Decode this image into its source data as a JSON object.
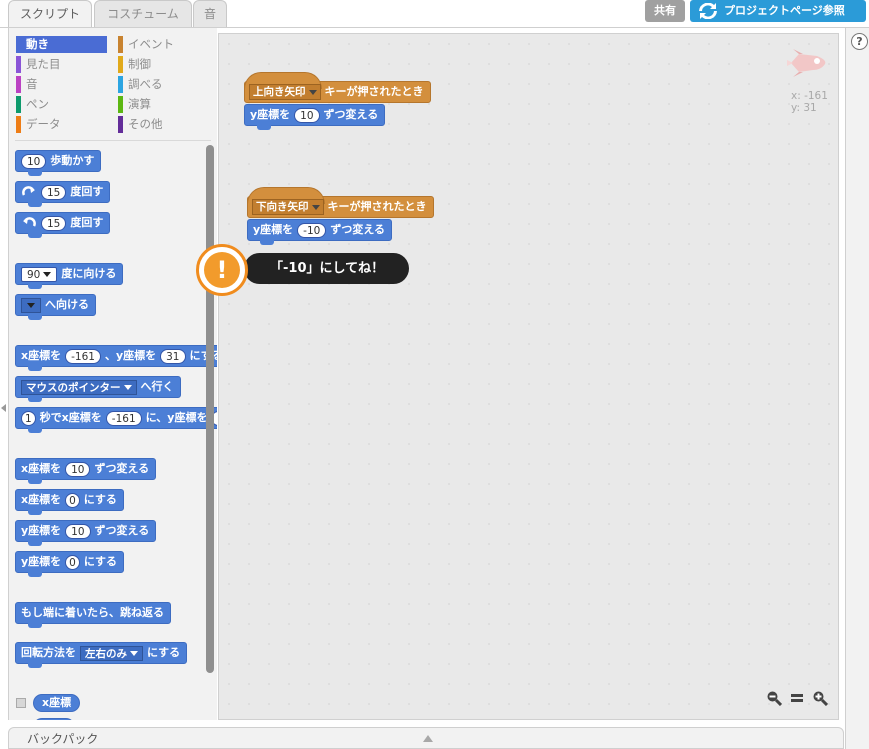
{
  "tabs": [
    "スクリプト",
    "コスチューム",
    "音"
  ],
  "header": {
    "share_label": "共有",
    "project_page_label": "プロジェクトページ参照"
  },
  "categories": {
    "left": [
      {
        "label": "動き",
        "color": "#4a6cd4",
        "active": true
      },
      {
        "label": "見た目",
        "color": "#8a55d7"
      },
      {
        "label": "音",
        "color": "#bb42c3"
      },
      {
        "label": "ペン",
        "color": "#0e9a6c"
      },
      {
        "label": "データ",
        "color": "#ee7d16"
      }
    ],
    "right": [
      {
        "label": "イベント",
        "color": "#c88330"
      },
      {
        "label": "制御",
        "color": "#e1a91a"
      },
      {
        "label": "調べる",
        "color": "#2ca5e2"
      },
      {
        "label": "演算",
        "color": "#5cb712"
      },
      {
        "label": "その他",
        "color": "#632d99"
      }
    ]
  },
  "palette": {
    "move": {
      "value": "10",
      "text": "歩動かす"
    },
    "turn_right": {
      "value": "15",
      "text": "度回す"
    },
    "turn_left": {
      "value": "15",
      "text": "度回す"
    },
    "point_direction": {
      "value": "90",
      "text": "度に向ける"
    },
    "point_towards": {
      "text": "へ向ける"
    },
    "goto_xy": {
      "x_label": "x座標を",
      "x": "-161",
      "y_label": "、y座標を",
      "y": "31",
      "suffix": "にする"
    },
    "goto": {
      "dropdown": "マウスのポインター",
      "text": "へ行く"
    },
    "glide": {
      "secs": "1",
      "t1": "秒でx座標を",
      "x": "-161",
      "t2": "に、y座標を"
    },
    "change_x": {
      "label": "x座標を",
      "value": "10",
      "text": "ずつ変える"
    },
    "set_x": {
      "label": "x座標を",
      "value": "0",
      "text": "にする"
    },
    "change_y": {
      "label": "y座標を",
      "value": "10",
      "text": "ずつ変える"
    },
    "set_y": {
      "label": "y座標を",
      "value": "0",
      "text": "にする"
    },
    "bounce": {
      "text": "もし端に着いたら、跳ね返る"
    },
    "rotation_style": {
      "label": "回転方法を",
      "dropdown": "左右のみ",
      "text": "にする"
    },
    "x_reporter": "x座標"
  },
  "scripts": [
    {
      "key_dropdown": "上向き矢印",
      "hat_text": "キーが押されたとき",
      "block_label": "y座標を",
      "value": "10",
      "block_text": "ずつ変える"
    },
    {
      "key_dropdown": "下向き矢印",
      "hat_text": "キーが押されたとき",
      "block_label": "y座標を",
      "value": "-10",
      "block_text": "ずつ変える"
    }
  ],
  "sprite_info": {
    "x": "x: -161",
    "y": "y: 31"
  },
  "callout": {
    "text": "「-10」にしてね！",
    "icon": "!"
  },
  "backpack": {
    "label": "バックパック"
  },
  "help": "?"
}
